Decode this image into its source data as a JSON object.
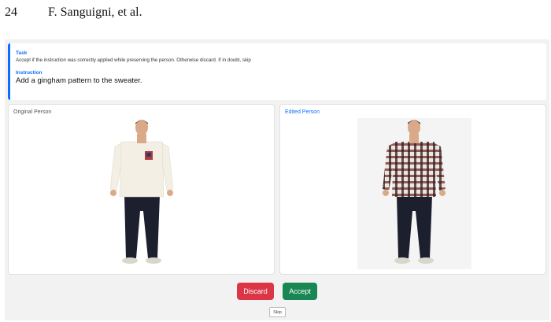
{
  "header": {
    "page_number": "24",
    "running_title": "F. Sanguigni, et al."
  },
  "task": {
    "label": "Task",
    "text": "Accept if the instruction was correctly applied while preserving the person. Otherwise discard. If in doubt, skip"
  },
  "instruction": {
    "label": "Instruction",
    "text": "Add a gingham pattern to the sweater."
  },
  "original": {
    "title": "Original Person"
  },
  "edited": {
    "title": "Edited Person"
  },
  "buttons": {
    "discard": "Discard",
    "accept": "Accept",
    "skip": "Skip"
  },
  "colors": {
    "accent": "#0d6efd",
    "discard": "#dc3545",
    "accept": "#198754"
  }
}
